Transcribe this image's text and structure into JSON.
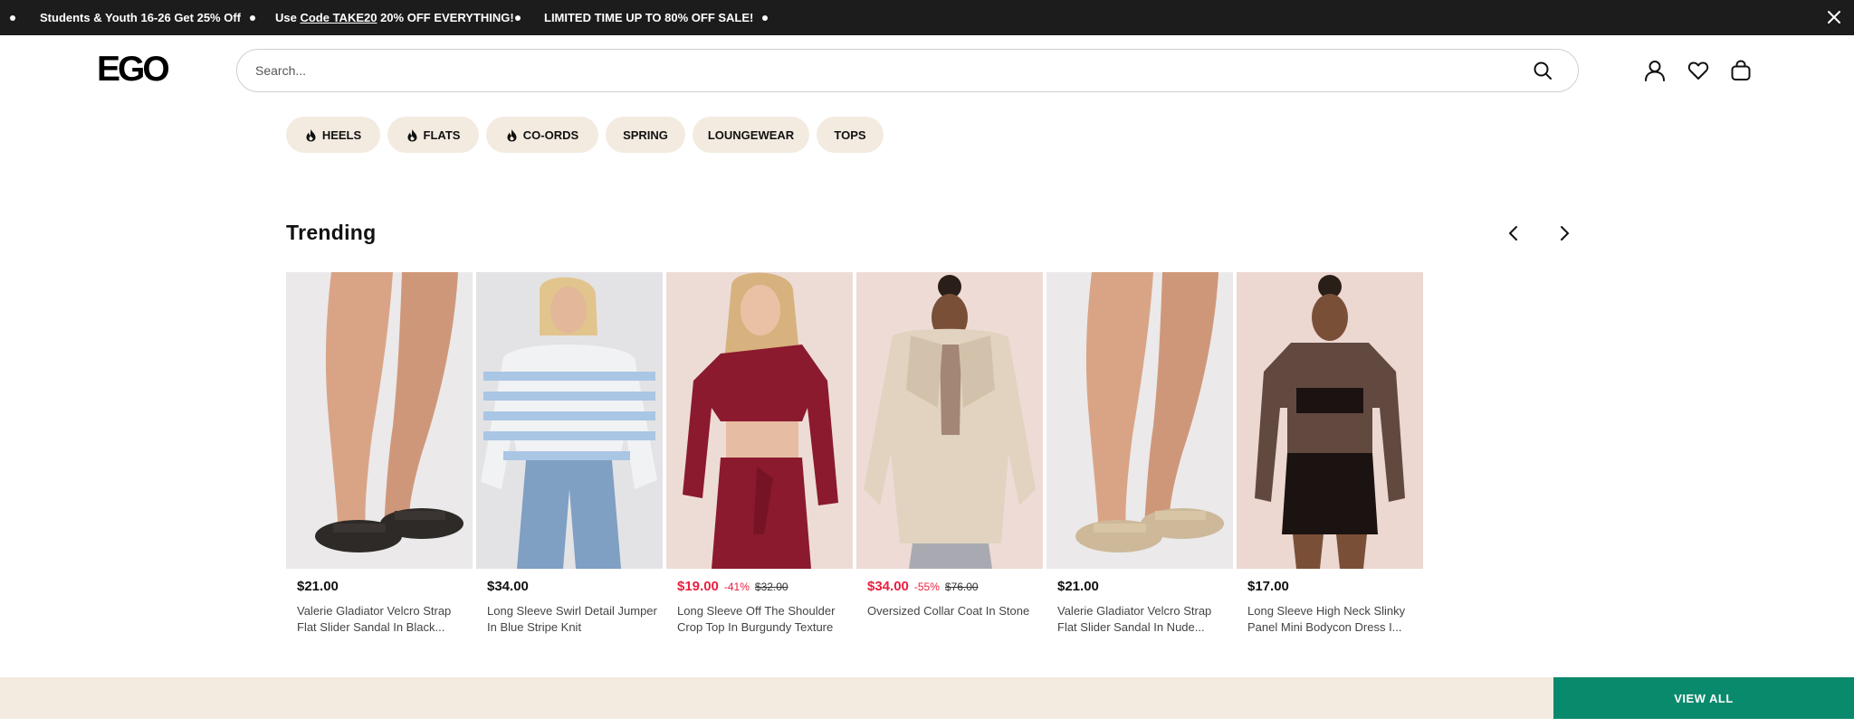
{
  "announcement": {
    "messages": [
      {
        "text": "Students & Youth 16-26 Get 25% Off"
      },
      {
        "prefix": "Use ",
        "code": "Code TAKE20",
        "suffix": " 20% OFF EVERYTHING!"
      },
      {
        "text": "LIMITED TIME UP TO 80% OFF SALE!"
      }
    ],
    "close_icon": "close-icon"
  },
  "header": {
    "logo": "EGO",
    "search": {
      "placeholder": "Search...",
      "value": "",
      "icon": "search-icon"
    },
    "icons": [
      "account-icon",
      "wishlist-heart-icon",
      "bag-icon"
    ]
  },
  "categories": [
    {
      "label": "HEELS",
      "icon": "flame-icon"
    },
    {
      "label": "FLATS",
      "icon": "flame-icon"
    },
    {
      "label": "CO-ORDS",
      "icon": "flame-icon"
    },
    {
      "label": "SPRING"
    },
    {
      "label": "LOUNGEWEAR"
    },
    {
      "label": "TOPS"
    }
  ],
  "trending": {
    "title": "Trending",
    "prev_icon": "chevron-left-icon",
    "next_icon": "chevron-right-icon",
    "products": [
      {
        "price": "$21.00",
        "name": "Valerie Gladiator Velcro Strap Flat Slider Sandal In Black...",
        "image": "black-slider-sandals"
      },
      {
        "price": "$34.00",
        "name": "Long Sleeve Swirl Detail Jumper In Blue Stripe Knit",
        "image": "blue-stripe-jumper"
      },
      {
        "price": "$19.00",
        "discount": "-41%",
        "was": "$32.00",
        "name": "Long Sleeve Off The Shoulder Crop Top In Burgundy Texture",
        "image": "burgundy-crop-top"
      },
      {
        "price": "$34.00",
        "discount": "-55%",
        "was": "$76.00",
        "name": "Oversized Collar Coat In Stone",
        "image": "stone-faux-fur-coat"
      },
      {
        "price": "$21.00",
        "name": "Valerie Gladiator Velcro Strap Flat Slider Sandal In Nude...",
        "image": "nude-slider-sandals"
      },
      {
        "price": "$17.00",
        "name": "Long Sleeve High Neck Slinky Panel Mini Bodycon Dress I...",
        "image": "black-mesh-bodycon-dress"
      }
    ]
  },
  "footer": {
    "view_all": "VIEW ALL"
  },
  "colors": {
    "accent_green": "#0a8a6c",
    "sale_red": "#e8203f",
    "pill_beige": "#f3ebe0",
    "announcement_bg": "#1c1c1c"
  }
}
